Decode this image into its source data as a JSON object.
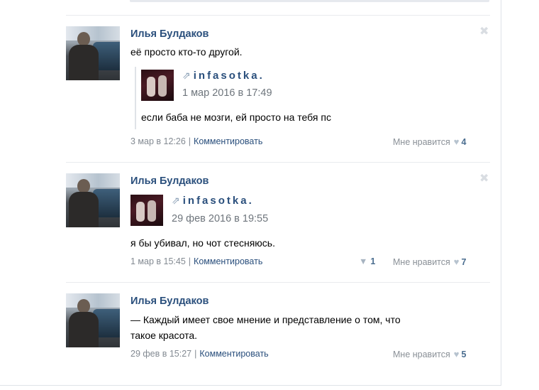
{
  "posts": [
    {
      "author": "Илья Булдаков",
      "text": "её просто        кто-то другой.",
      "repost": {
        "source": "infasotka.",
        "date": "1 мар 2016 в 17:49",
        "text": "если баба не         мозги, ей просто на тебя пс"
      },
      "time": "3 мар в 12:26",
      "comment_label": "Комментировать",
      "like_label": "Мне нравится",
      "like_count": "4"
    },
    {
      "author": "Илья Булдаков",
      "repost": {
        "source": "infasotka.",
        "date": "29 фев 2016 в 19:55"
      },
      "text": "я бы убивал, но чот стесняюсь.",
      "time": "1 мар в 15:45",
      "comment_label": "Комментировать",
      "share_count": "1",
      "like_label": "Мне нравится",
      "like_count": "7"
    },
    {
      "author": "Илья Булдаков",
      "text_line1": "— Каждый имеет свое мнение и представление о том, что",
      "text_line2": "такое красота.",
      "time": "29 фев в 15:27",
      "comment_label": "Комментировать",
      "like_label": "Мне нравится",
      "like_count": "5"
    }
  ],
  "icons": {
    "close": "✖",
    "repost": "⇗",
    "heart": "♥",
    "megaphone": "📢"
  }
}
